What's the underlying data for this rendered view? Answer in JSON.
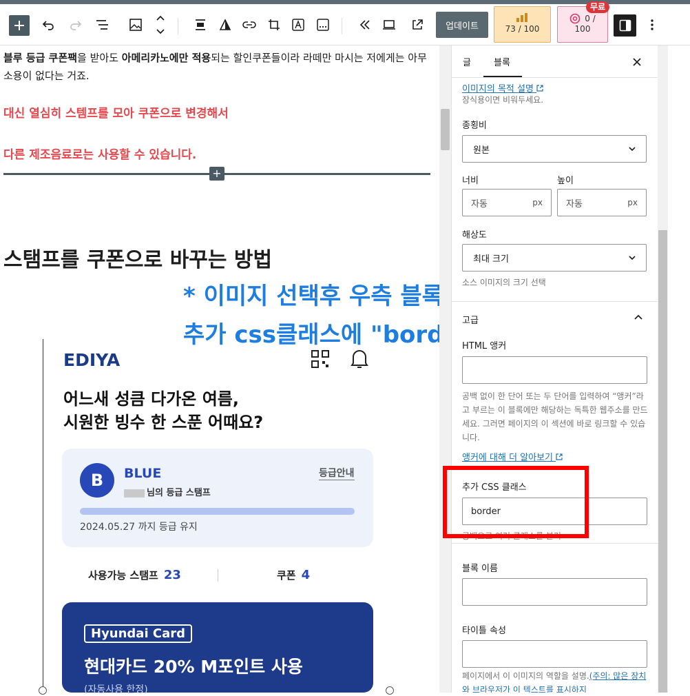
{
  "toolbar": {
    "update_label": "업데이트",
    "score1": "73 / 100",
    "score2_line1": "0 /",
    "score2_line2": "100",
    "free_badge": "무료"
  },
  "editor": {
    "para_bold1": "블루 등급 쿠폰팩",
    "para_t1": "을 받아도 ",
    "para_bold2": "아메리카노에만 적용",
    "para_t2": "되는 할인쿠폰들이라 라떼만 마시는 저에게는 아무 소용이 없다는 거죠.",
    "red1": "대신 열심히 스템프를 모아 쿠폰으로 변경해서",
    "red2": "다른 제조음료로는 사용할 수 있습니다.",
    "heading": "스탬프를 쿠폰으로 바꾸는 방법",
    "overlay1": "* 이미지 선택후 우측 블록에서",
    "overlay2": "추가 css클래스에 \"border\"입력"
  },
  "image": {
    "brand": "EDIYA",
    "hero1": "어느새 성큼 다가온 여름,",
    "hero2": "시원한 빙수 한 스푼 어때요?",
    "avatar": "B",
    "grade": "BLUE",
    "grade_sub": "님의 등급 스탬프",
    "grade_info": "등급안내",
    "keep_date": "2024.05.27 까지 등급 유지",
    "progress": 1.0,
    "stamp_label": "사용가능 스탬프",
    "stamp_count": "23",
    "coupon_label": "쿠폰",
    "coupon_count": "4",
    "card_brand": "Hyundai Card",
    "card_text": "현대카드 20% M포인트 사용",
    "card_sub": "(자동사용 한정)"
  },
  "sidebar": {
    "tab_post": "글",
    "tab_block": "블록",
    "alt_link": "이미지의 목적 설명",
    "alt_help": "장식용이면 비워두세요.",
    "aspect_label": "종횡비",
    "aspect_value": "원본",
    "width_label": "너비",
    "height_label": "높이",
    "width_value": "자동",
    "height_value": "자동",
    "unit": "px",
    "resolution_label": "해상도",
    "resolution_value": "최대 크기",
    "resolution_help": "소스 이미지의 크기 선택",
    "advanced_label": "고급",
    "anchor_label": "HTML 앵커",
    "anchor_help": "공백 없이 한 단어 또는 두 단어를 입력하여 “앵커”라고 부르는 이 블록에만 해당하는 독특한 웹주소를 만드세요. 그러면 페이지의 이 섹션에 바로 링크할 수 있습니다.",
    "anchor_link": "앵커에 대해 더 알아보기",
    "css_label": "추가 CSS 클래스",
    "css_value": "border",
    "css_help": "공백으로 여러 클래스를 분리",
    "block_name_label": "블록 이름",
    "title_attr_label": "타이틀 속성",
    "title_help_text": "페이지에서 이 이미지의 역할을 설명.",
    "title_help_link": "(주의: 많은 장치와 브라우저가 이 텍스트를 표시하지"
  }
}
